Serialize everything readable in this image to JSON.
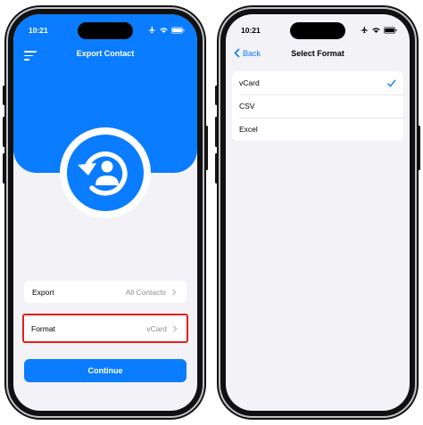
{
  "phone1": {
    "status": {
      "time": "10:21"
    },
    "nav_title": "Export Contact",
    "rows": [
      {
        "label": "Export",
        "value": "All Contacts"
      },
      {
        "label": "Format",
        "value": "vCard"
      }
    ],
    "continue_label": "Continue"
  },
  "phone2": {
    "status": {
      "time": "10:21"
    },
    "back_label": "Back",
    "nav_title": "Select Format",
    "options": [
      {
        "label": "vCard",
        "selected": true
      },
      {
        "label": "CSV",
        "selected": false
      },
      {
        "label": "Excel",
        "selected": false
      }
    ]
  },
  "colors": {
    "accent": "#0a7cff",
    "highlight": "#e0211a",
    "background": "#f2f2f7"
  },
  "icons": [
    "menu-icon",
    "contact-restore-icon",
    "chevron-right-icon",
    "chevron-left-icon",
    "checkmark-icon",
    "airplane-icon",
    "wifi-icon",
    "battery-icon"
  ]
}
